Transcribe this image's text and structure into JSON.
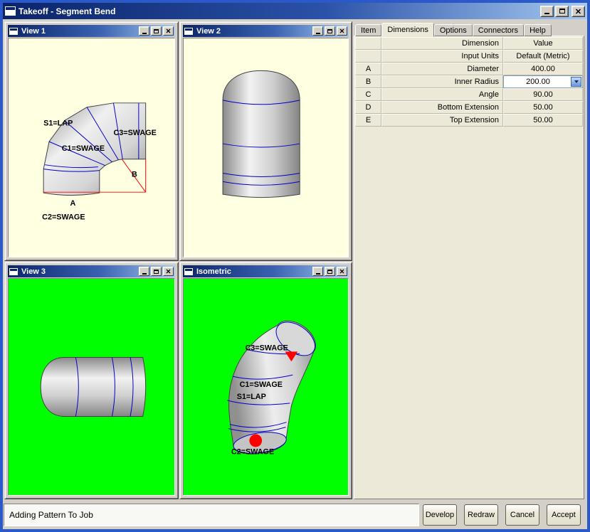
{
  "window": {
    "title": "Takeoff - Segment Bend"
  },
  "views": {
    "view1": {
      "title": "View 1",
      "labels": {
        "s1": "S1=LAP",
        "c3": "C3=SWAGE",
        "c1": "C1=SWAGE",
        "b": "B",
        "a": "A",
        "c2": "C2=SWAGE"
      }
    },
    "view2": {
      "title": "View 2"
    },
    "view3": {
      "title": "View 3"
    },
    "isometric": {
      "title": "Isometric",
      "labels": {
        "c3": "C3=SWAGE",
        "c1": "C1=SWAGE",
        "s1": "S1=LAP",
        "c2": "C2=SWAGE"
      }
    }
  },
  "panel": {
    "tabs": {
      "item": "Item",
      "dimensions": "Dimensions",
      "options": "Options",
      "connectors": "Connectors",
      "help": "Help"
    },
    "grid": {
      "col_dimension": "Dimension",
      "col_value": "Value",
      "rows": [
        {
          "key": "",
          "dimension": "Input Units",
          "value": "Default (Metric)"
        },
        {
          "key": "A",
          "dimension": "Diameter",
          "value": "400.00"
        },
        {
          "key": "B",
          "dimension": "Inner Radius",
          "value": "200.00"
        },
        {
          "key": "C",
          "dimension": "Angle",
          "value": "90.00"
        },
        {
          "key": "D",
          "dimension": "Bottom Extension",
          "value": "50.00"
        },
        {
          "key": "E",
          "dimension": "Top Extension",
          "value": "50.00"
        }
      ]
    }
  },
  "statusbar": {
    "text": "Adding Pattern To Job"
  },
  "buttons": {
    "develop": "Develop",
    "redraw": "Redraw",
    "cancel": "Cancel",
    "accept": "Accept"
  },
  "colors": {
    "titlebar_start": "#0A246A",
    "titlebar_end": "#A6CAF0",
    "window_bg": "#D4D0C8",
    "panel_bg": "#ECE9D8",
    "view_bg_cream": "#FFFFE1",
    "view_bg_green": "#00FF00",
    "line_blue": "#0000C8",
    "marker_red": "#FF0000"
  }
}
